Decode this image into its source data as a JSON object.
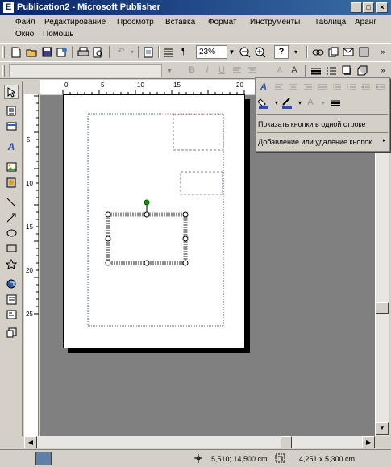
{
  "window": {
    "title": "Publication2 - Microsoft Publisher",
    "app_icon_glyph": "E",
    "controls": [
      "_",
      "□",
      "×"
    ]
  },
  "menubar": {
    "row1": [
      "Файл",
      "Редактирование",
      "Просмотр",
      "Вставка",
      "Формат",
      "Инструменты",
      "Таблица",
      "Aранг"
    ],
    "row2": [
      "Окно",
      "Помощь"
    ]
  },
  "toolbar": {
    "zoom_value": "23%",
    "paragraph_mark": "¶",
    "help_glyph": "?"
  },
  "dropdown": {
    "show_one_row": "Показать кнопки в одной строке",
    "add_remove": "Добавление или удаление кнопок"
  },
  "hruler": {
    "ticks": [
      "0",
      "5",
      "10",
      "15",
      "20"
    ]
  },
  "vruler": {
    "ticks": [
      "5",
      "10",
      "15",
      "20",
      "25"
    ]
  },
  "statusbar": {
    "position": "5,510; 14,500 cm",
    "size": "4,251 x 5,300 cm"
  },
  "icons": {
    "new": "new-document-icon",
    "open": "open-folder-icon",
    "save": "save-icon",
    "print": "print-icon",
    "preview": "print-preview-icon",
    "undo": "undo-icon",
    "zoom_in": "zoom-in-icon",
    "zoom_out": "zoom-out-icon",
    "help": "help-icon"
  },
  "colors": {
    "titlebar": "#0a246a",
    "guide_blue": "#4060d0",
    "guide_pink": "#e080a0",
    "rotation_handle": "#00a000"
  }
}
